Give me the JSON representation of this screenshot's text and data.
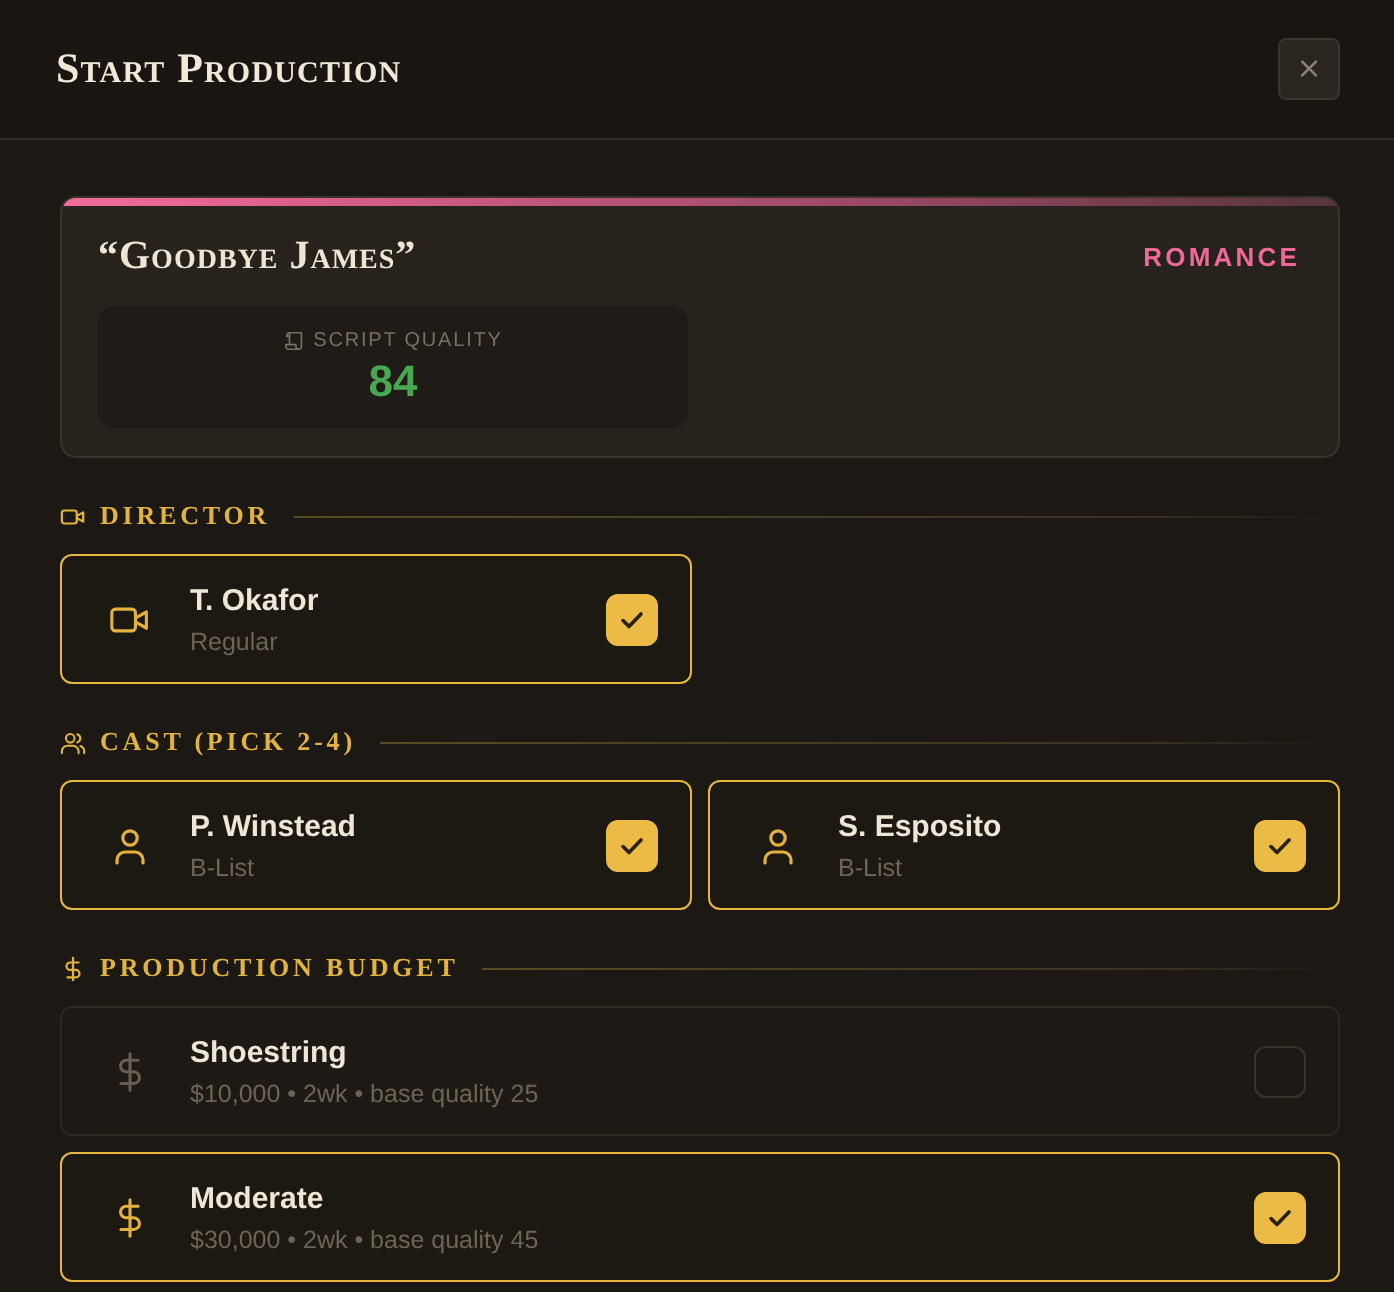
{
  "dialog": {
    "title": "Start Production",
    "close": "×"
  },
  "script": {
    "title": "“Goodbye James”",
    "genre": "ROMANCE",
    "quality": {
      "label": "SCRIPT QUALITY",
      "value": "84"
    }
  },
  "sections": [
    {
      "kind": "director",
      "heading": "DIRECTOR",
      "options": [
        {
          "name": "T. Okafor",
          "detail": "Regular",
          "selected": true
        }
      ]
    },
    {
      "kind": "cast",
      "heading": "CAST (PICK 2-4)",
      "options": [
        {
          "name": "P. Winstead",
          "detail": "B-List",
          "selected": true
        },
        {
          "name": "S. Esposito",
          "detail": "B-List",
          "selected": true
        }
      ]
    },
    {
      "kind": "budget",
      "heading": "PRODUCTION BUDGET",
      "options": [
        {
          "name": "Shoestring",
          "detail": "$10,000 • 2wk • base quality 25",
          "selected": false
        },
        {
          "name": "Moderate",
          "detail": "$30,000 • 2wk • base quality 45",
          "selected": true
        }
      ]
    }
  ]
}
